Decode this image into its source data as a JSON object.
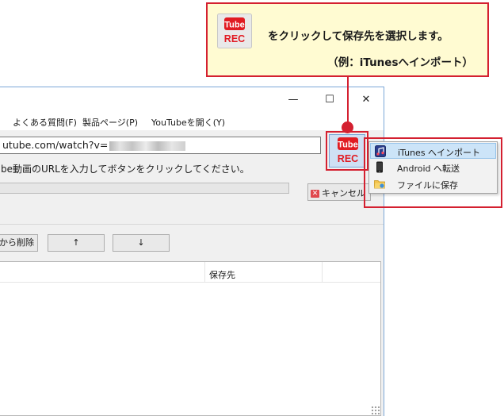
{
  "callout": {
    "line1": "をクリックして保存先を選択します。",
    "line2": "（例：iTunesへインポート）",
    "icon_text": {
      "top": "Tube",
      "bottom": "REC"
    }
  },
  "window": {
    "controls": {
      "minimize": "—",
      "maximize": "☐",
      "close": "✕"
    },
    "menu": [
      "よくある質問(F)",
      "製品ページ(P)",
      "YouTubeを開く(Y)"
    ],
    "url": {
      "value": "utube.com/watch?v=",
      "obscured": true
    },
    "hint": "be動画のURLを入力してボタンをクリックしてください。",
    "progress": 0,
    "cancel_label": "キャンセル",
    "list_buttons": {
      "delete": "から削除",
      "up": "↑",
      "down": "↓"
    },
    "table": {
      "columns": [
        "保存先"
      ]
    },
    "rec_button": {
      "top": "Tube",
      "bottom": "REC"
    }
  },
  "dropdown": {
    "items": [
      {
        "label": "iTunes へインポート",
        "icon": "itunes-icon",
        "highlighted": true
      },
      {
        "label": "Android へ転送",
        "icon": "android-phone-icon",
        "highlighted": false
      },
      {
        "label": "ファイルに保存",
        "icon": "folder-icon",
        "highlighted": false
      }
    ]
  },
  "colors": {
    "accent_red": "#d42030",
    "callout_bg": "#fffbd2",
    "menu_hover": "#cce4f8",
    "logo_red": "#e11b22"
  }
}
